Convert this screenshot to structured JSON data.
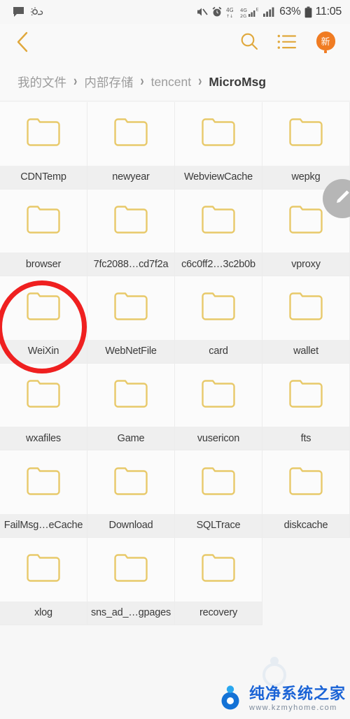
{
  "status_bar": {
    "left_icons": [
      "message-bubble-icon",
      "weather-icon"
    ],
    "right_icons": [
      "mute-icon",
      "alarm-icon",
      "signal-4g-icon",
      "signal-4g-2g-icon",
      "signal-bars-icon",
      "battery-icon"
    ],
    "battery_text": "63%",
    "time": "11:05"
  },
  "toolbar": {
    "back_icon": "chevron-left-icon",
    "search_icon": "search-icon",
    "list_icon": "list-view-icon",
    "new_badge_label": "新"
  },
  "breadcrumb": {
    "separator": "›",
    "items": [
      {
        "label": "我的文件",
        "current": false
      },
      {
        "label": "内部存储",
        "current": false
      },
      {
        "label": "tencent",
        "current": false
      },
      {
        "label": "MicroMsg",
        "current": true
      }
    ]
  },
  "grid": {
    "columns": 4,
    "items": [
      {
        "name": "CDNTemp",
        "type": "folder"
      },
      {
        "name": "newyear",
        "type": "folder"
      },
      {
        "name": "WebviewCache",
        "type": "folder"
      },
      {
        "name": "wepkg",
        "type": "folder"
      },
      {
        "name": "browser",
        "type": "folder"
      },
      {
        "name": "7fc2088…cd7f2a",
        "type": "folder"
      },
      {
        "name": "c6c0ff2…3c2b0b",
        "type": "folder"
      },
      {
        "name": "vproxy",
        "type": "folder"
      },
      {
        "name": "WeiXin",
        "type": "folder",
        "highlighted": true
      },
      {
        "name": "WebNetFile",
        "type": "folder"
      },
      {
        "name": "card",
        "type": "folder"
      },
      {
        "name": "wallet",
        "type": "folder"
      },
      {
        "name": "wxafiles",
        "type": "folder"
      },
      {
        "name": "Game",
        "type": "folder"
      },
      {
        "name": "vusericon",
        "type": "folder"
      },
      {
        "name": "fts",
        "type": "folder"
      },
      {
        "name": "FailMsg…eCache",
        "type": "folder"
      },
      {
        "name": "Download",
        "type": "folder"
      },
      {
        "name": "SQLTrace",
        "type": "folder"
      },
      {
        "name": "diskcache",
        "type": "folder"
      },
      {
        "name": "xlog",
        "type": "folder"
      },
      {
        "name": "sns_ad_…gpages",
        "type": "folder"
      },
      {
        "name": "recovery",
        "type": "folder"
      }
    ]
  },
  "fab": {
    "icon": "pencil-edit-icon"
  },
  "annotation": {
    "shape": "ellipse",
    "color": "#ef2020",
    "target": "WeiXin"
  },
  "watermark": {
    "title": "纯净系统之家",
    "url": "www.kzmyhome.com",
    "logo": "circle-person-logo"
  },
  "colors": {
    "accent": "#e0a83c",
    "folder_outline": "#e8c96a",
    "badge_orange": "#f07c23",
    "annotation_red": "#ef2020",
    "watermark_blue": "#1a63d6",
    "cell_bg": "#fbfbfb",
    "label_bg": "#efefef"
  }
}
